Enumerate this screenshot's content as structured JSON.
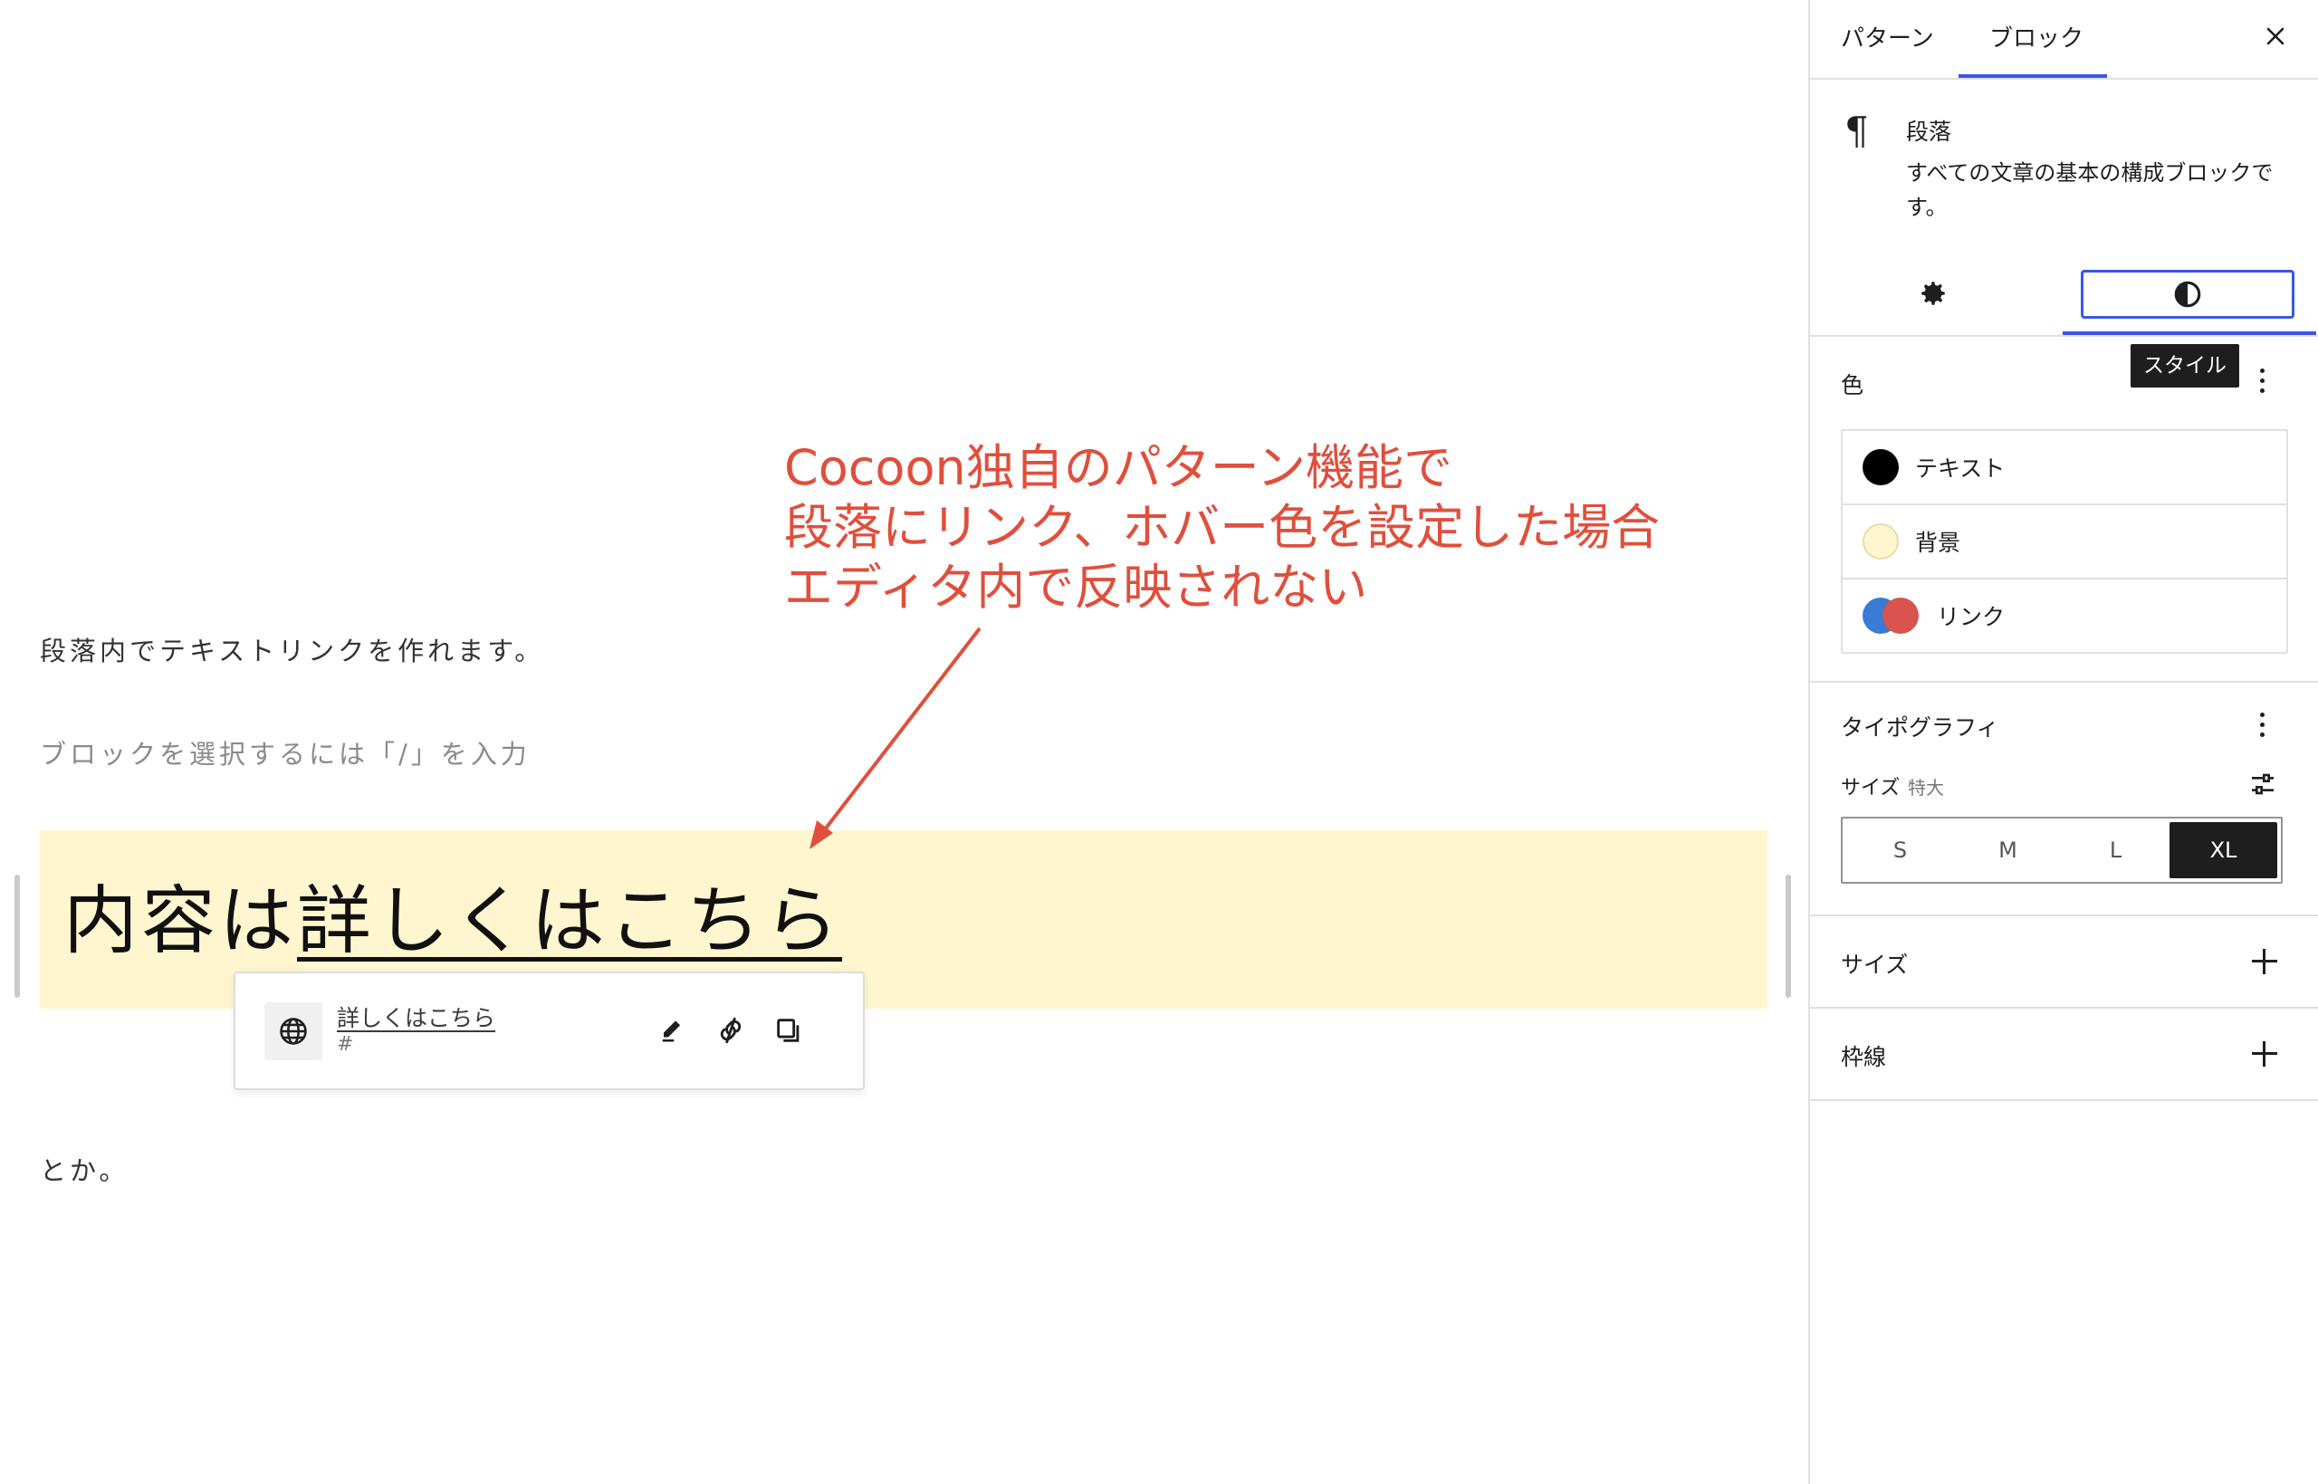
{
  "editor": {
    "paragraph1": "段落内でテキストリンクを作れます。",
    "placeholder": "ブロックを選択するには「/」を入力",
    "highlight_prefix": "内容は",
    "highlight_link": "詳しくはこちら",
    "paragraph3": "とか。"
  },
  "link_popover": {
    "title": "詳しくはこちら",
    "url": "#",
    "icons": [
      "globe-icon",
      "edit-icon",
      "unlink-icon",
      "copy-icon"
    ]
  },
  "annotation": {
    "lines": [
      "Cocoon独自のパターン機能で",
      "段落にリンク、ホバー色を設定した場合",
      "エディタ内で反映されない"
    ],
    "color": "#e04f3c"
  },
  "sidebar": {
    "tabs": [
      "パターン",
      "ブロック"
    ],
    "active_tab": "ブロック",
    "block_card": {
      "title": "段落",
      "description": "すべての文章の基本の構成ブロックです。"
    },
    "subtabs": [
      "settings",
      "styles"
    ],
    "tooltip": "スタイル",
    "color_panel": {
      "title": "色",
      "items": [
        {
          "label": "テキスト",
          "color": "#000000"
        },
        {
          "label": "背景",
          "color": "#fff6cf"
        },
        {
          "label": "リンク",
          "colors": [
            "#3a7bd5",
            "#d9534f"
          ]
        }
      ]
    },
    "typography_panel": {
      "title": "タイポグラフィ",
      "size_label": "サイズ",
      "size_value": "特大",
      "sizes": [
        "S",
        "M",
        "L",
        "XL"
      ],
      "active_size": "XL"
    },
    "size_panel": {
      "title": "サイズ"
    },
    "border_panel": {
      "title": "枠線"
    }
  },
  "colors": {
    "accent": "#3858e9",
    "highlight_bg": "#fff6cf"
  }
}
